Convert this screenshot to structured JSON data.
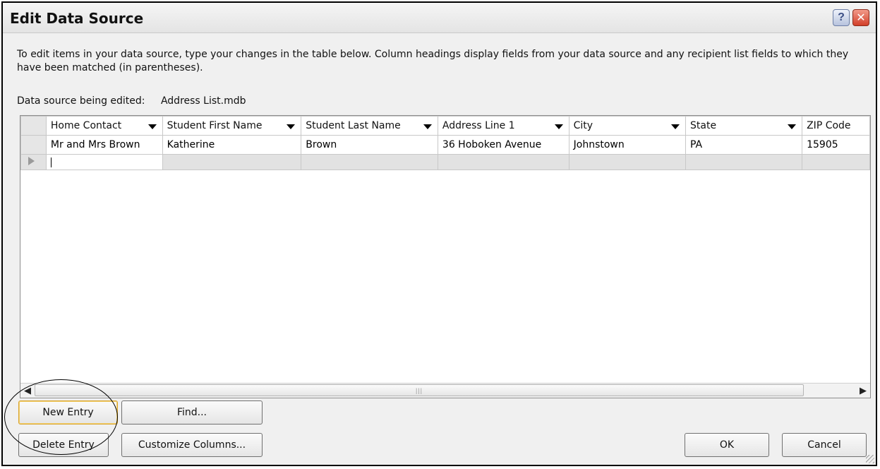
{
  "window": {
    "title": "Edit Data Source",
    "help_glyph": "?",
    "close_glyph": "✕"
  },
  "instructions": "To edit items in your data source, type your changes in the table below. Column headings display fields from your data source and any recipient list fields to which they have been matched (in parentheses).",
  "source": {
    "label": "Data source being edited:",
    "value": "Address List.mdb"
  },
  "table": {
    "columns": [
      "Home Contact",
      "Student First Name",
      "Student Last Name",
      "Address Line 1",
      "City",
      "State",
      "ZIP Code"
    ],
    "rows": [
      [
        "Mr and Mrs Brown",
        "Katherine",
        "Brown",
        "36 Hoboken Avenue",
        "Johnstown",
        "PA",
        "15905"
      ]
    ]
  },
  "scrollbar": {
    "left_glyph": "◀",
    "right_glyph": "▶",
    "thumb_grip": "|||"
  },
  "buttons": {
    "new_entry": "New Entry",
    "find": "Find...",
    "delete_entry": "Delete Entry",
    "customize_columns": "Customize Columns...",
    "ok": "OK",
    "cancel": "Cancel"
  },
  "colors": {
    "highlight_border": "#d9a52f",
    "close_button": "#d24029"
  }
}
